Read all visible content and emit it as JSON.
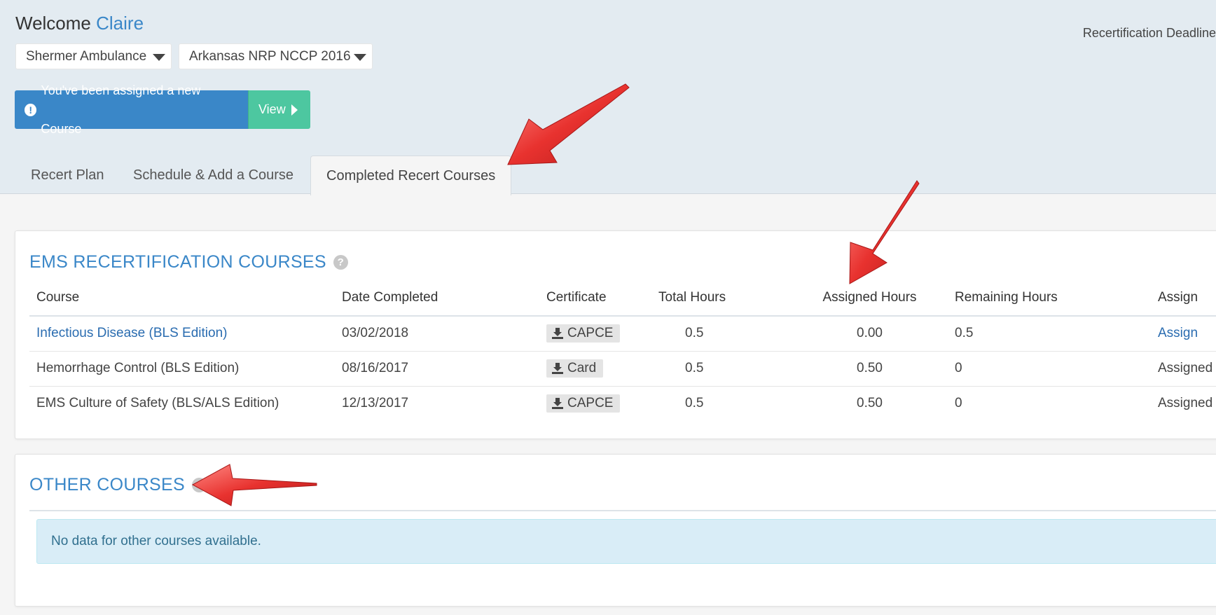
{
  "header": {
    "welcome": "Welcome",
    "user_name": "Claire",
    "deadline_label": "Recertification Deadline"
  },
  "selects": [
    {
      "value": "Shermer Ambulance"
    },
    {
      "value": "Arkansas NRP NCCP 2016"
    }
  ],
  "alert": {
    "message": "You've been assigned a new Course",
    "view_label": "View"
  },
  "tabs": [
    {
      "label": "Recert Plan"
    },
    {
      "label": "Schedule & Add a Course"
    },
    {
      "label": "Completed Recert Courses",
      "active": true
    }
  ],
  "ems": {
    "title": "EMS RECERTIFICATION COURSES",
    "columns": [
      "Course",
      "Date Completed",
      "Certificate",
      "Total Hours",
      "Assigned Hours",
      "Remaining Hours",
      "Assign"
    ],
    "rows": [
      {
        "course": "Infectious Disease (BLS Edition)",
        "date": "03/02/2018",
        "certificate": "CAPCE",
        "total": "0.5",
        "assigned": "0.00",
        "remaining": "0.5",
        "assign": "Assign"
      },
      {
        "course": "Hemorrhage Control (BLS Edition)",
        "date": "08/16/2017",
        "certificate": "Card",
        "total": "0.5",
        "assigned": "0.50",
        "remaining": "0",
        "assign": "Assigned"
      },
      {
        "course": "EMS Culture of Safety (BLS/ALS Edition)",
        "date": "12/13/2017",
        "certificate": "CAPCE",
        "total": "0.5",
        "assigned": "0.50",
        "remaining": "0",
        "assign": "Assigned"
      }
    ]
  },
  "other": {
    "title": "OTHER COURSES",
    "empty_message": "No data for other courses available."
  },
  "colors": {
    "accent_blue": "#3a87c8",
    "view_green": "#4dc7a0",
    "arrow_red": "#e8322f"
  }
}
